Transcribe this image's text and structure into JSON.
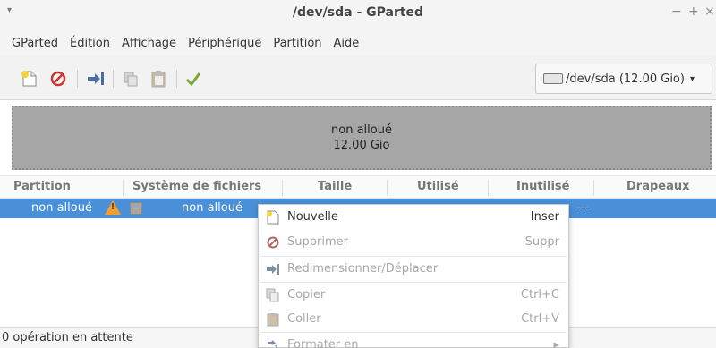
{
  "window": {
    "title": "/dev/sda - GParted",
    "menu_arrow": "▾",
    "minimize": "−",
    "maximize": "+",
    "close": "×"
  },
  "menubar": {
    "items": [
      "GParted",
      "Édition",
      "Affichage",
      "Périphérique",
      "Partition",
      "Aide"
    ]
  },
  "toolbar": {
    "device_selector": "/dev/sda  (12.00 Gio)",
    "device_caret": "▾"
  },
  "disk_graphic": {
    "label": "non alloué",
    "size": "12.00 Gio"
  },
  "table": {
    "columns": [
      "Partition",
      "Système de fichiers",
      "Taille",
      "Utilisé",
      "Inutilisé",
      "Drapeaux"
    ],
    "rows": [
      {
        "partition": "non alloué",
        "warning": "!",
        "filesystem": "non alloué",
        "unused": "---"
      }
    ]
  },
  "status": {
    "text": "0 opération en attente"
  },
  "context_menu": {
    "items": [
      {
        "label": "Nouvelle",
        "shortcut": "Inser"
      },
      {
        "label": "Supprimer",
        "shortcut": "Suppr"
      },
      {
        "label": "Redimensionner/Déplacer",
        "shortcut": ""
      },
      {
        "label": "Copier",
        "shortcut": "Ctrl+C"
      },
      {
        "label": "Coller",
        "shortcut": "Ctrl+V"
      },
      {
        "label": "Formater en",
        "shortcut": "▸"
      }
    ]
  },
  "colors": {
    "selection": "#4a90d9",
    "unallocated": "#a6a6a6",
    "warning": "#f0a030",
    "apply_check": "#7aa63a",
    "delete_red": "#cc3333"
  }
}
